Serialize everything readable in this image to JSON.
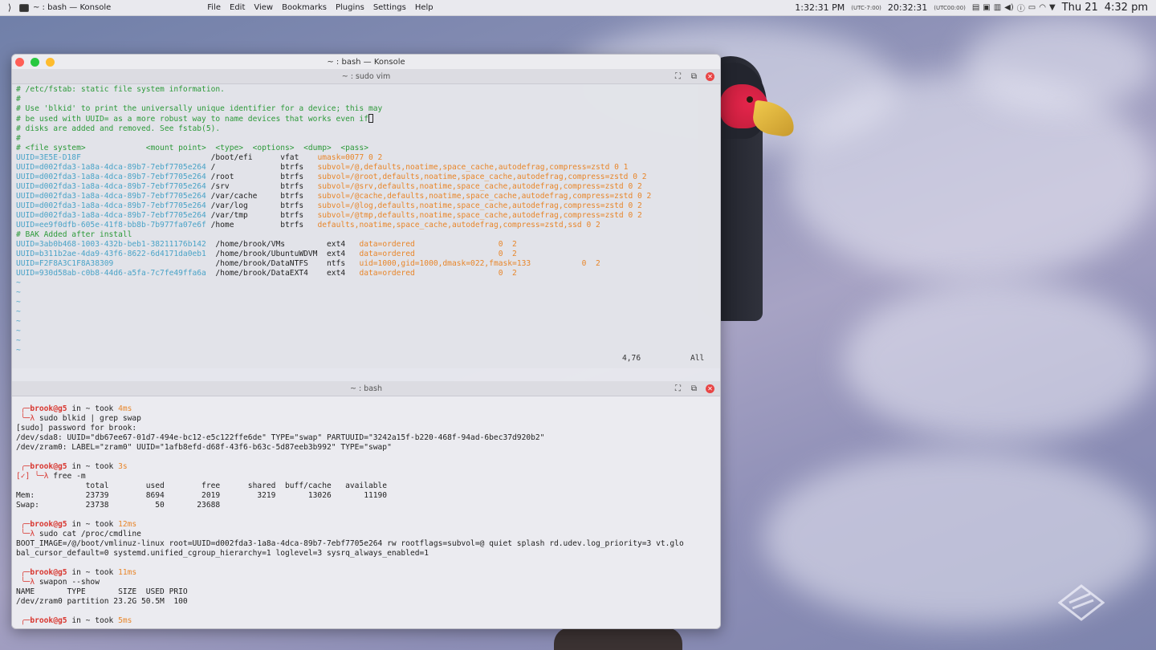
{
  "panel": {
    "launcher_icon": "plasma-launcher-icon",
    "app_title": "~ : bash — Konsole",
    "menu": [
      "File",
      "Edit",
      "View",
      "Bookmarks",
      "Plugins",
      "Settings",
      "Help"
    ],
    "clock1": "1:32:31 PM",
    "tz1": "(UTC-7:00)",
    "clock2": "20:32:31",
    "tz2": "(UTC00:00)",
    "day": "Thu 21",
    "time": "4:32 pm"
  },
  "window": {
    "title": "~ : bash — Konsole",
    "vim_pane_title": "~ : sudo vim",
    "bash_pane_title": "~ : bash"
  },
  "vim": {
    "comments": [
      "# /etc/fstab: static file system information.",
      "#",
      "# Use 'blkid' to print the universally unique identifier for a device; this may",
      "# be used with UUID= as a more robust way to name devices that works even if",
      "# disks are added and removed. See fstab(5).",
      "#",
      "# <file system>             <mount point>  <type>  <options>  <dump>  <pass>"
    ],
    "entries": [
      {
        "uuid": "UUID=3E5E-D18F",
        "pad": "                            ",
        "mp": "/boot/efi      ",
        "type": "vfat    ",
        "opts": "umask=0077 0 2"
      },
      {
        "uuid": "UUID=d002fda3-1a8a-4dca-89b7-7ebf7705e264",
        "pad": " ",
        "mp": "/              ",
        "type": "btrfs   ",
        "opts": "subvol=/@,defaults,noatime,space_cache,autodefrag,compress=zstd 0 1"
      },
      {
        "uuid": "UUID=d002fda3-1a8a-4dca-89b7-7ebf7705e264",
        "pad": " ",
        "mp": "/root          ",
        "type": "btrfs   ",
        "opts": "subvol=/@root,defaults,noatime,space_cache,autodefrag,compress=zstd 0 2"
      },
      {
        "uuid": "UUID=d002fda3-1a8a-4dca-89b7-7ebf7705e264",
        "pad": " ",
        "mp": "/srv           ",
        "type": "btrfs   ",
        "opts": "subvol=/@srv,defaults,noatime,space_cache,autodefrag,compress=zstd 0 2"
      },
      {
        "uuid": "UUID=d002fda3-1a8a-4dca-89b7-7ebf7705e264",
        "pad": " ",
        "mp": "/var/cache     ",
        "type": "btrfs   ",
        "opts": "subvol=/@cache,defaults,noatime,space_cache,autodefrag,compress=zstd 0 2"
      },
      {
        "uuid": "UUID=d002fda3-1a8a-4dca-89b7-7ebf7705e264",
        "pad": " ",
        "mp": "/var/log       ",
        "type": "btrfs   ",
        "opts": "subvol=/@log,defaults,noatime,space_cache,autodefrag,compress=zstd 0 2"
      },
      {
        "uuid": "UUID=d002fda3-1a8a-4dca-89b7-7ebf7705e264",
        "pad": " ",
        "mp": "/var/tmp       ",
        "type": "btrfs   ",
        "opts": "subvol=/@tmp,defaults,noatime,space_cache,autodefrag,compress=zstd 0 2"
      },
      {
        "uuid": "UUID=ee9f0dfb-605e-41f8-bb8b-7b977fa07e6f",
        "pad": " ",
        "mp": "/home          ",
        "type": "btrfs   ",
        "opts": "defaults,noatime,space_cache,autodefrag,compress=zstd,ssd 0 2"
      }
    ],
    "bak_comment": "# BAK Added after install",
    "bak_entries": [
      {
        "uuid": "UUID=3ab0b468-1003-432b-beb1-38211176b142",
        "pad": "  ",
        "mp": "/home/brook/VMs         ",
        "type": "ext4   ",
        "opts": "data=ordered                  0  2"
      },
      {
        "uuid": "UUID=b311b2ae-4da9-43f6-8622-6d4171da0eb1",
        "pad": "  ",
        "mp": "/home/brook/UbuntuWDVM  ",
        "type": "ext4   ",
        "opts": "data=ordered                  0  2"
      },
      {
        "uuid": "UUID=F2F8A3C1F8A38309",
        "pad": "                      ",
        "mp": "/home/brook/DataNTFS    ",
        "type": "ntfs   ",
        "opts": "uid=1000,gid=1000,dmask=022,fmask=133           0  2"
      },
      {
        "uuid": "UUID=930d58ab-c0b8-44d6-a5fa-7c7fe49ffa6a",
        "pad": "  ",
        "mp": "/home/brook/DataEXT4    ",
        "type": "ext4   ",
        "opts": "data=ordered                  0  2"
      }
    ],
    "tildes": [
      "~",
      "~",
      "~",
      "~",
      "~",
      "~",
      "~",
      "~"
    ],
    "status_pos": "4,76",
    "status_all": "All"
  },
  "bash": {
    "blocks": [
      {
        "prompt_user": "brook@g5",
        "prompt_mid": " in ~ took ",
        "took": "4ms",
        "cmd": "sudo blkid | grep swap",
        "check": "",
        "output": [
          "[sudo] password for brook:",
          "/dev/sda8: UUID=\"db67ee67-01d7-494e-bc12-e5c122ffe6de\" TYPE=\"swap\" PARTUUID=\"3242a15f-b220-468f-94ad-6bec37d920b2\"",
          "/dev/zram0: LABEL=\"zram0\" UUID=\"1afb8efd-d68f-43f6-b63c-5d87eeb3b992\" TYPE=\"swap\""
        ]
      },
      {
        "prompt_user": "brook@g5",
        "prompt_mid": " in ~ took ",
        "took": "3s",
        "cmd": "free -m",
        "check": "[✓]",
        "output": [
          "               total        used        free      shared  buff/cache   available",
          "Mem:           23739        8694        2019        3219       13026       11190",
          "Swap:          23738          50       23688"
        ]
      },
      {
        "prompt_user": "brook@g5",
        "prompt_mid": " in ~ took ",
        "took": "12ms",
        "cmd": "sudo cat /proc/cmdline",
        "check": "",
        "output": [
          "BOOT_IMAGE=/@/boot/vmlinuz-linux root=UUID=d002fda3-1a8a-4dca-89b7-7ebf7705e264 rw rootflags=subvol=@ quiet splash rd.udev.log_priority=3 vt.glo",
          "bal_cursor_default=0 systemd.unified_cgroup_hierarchy=1 loglevel=3 sysrq_always_enabled=1"
        ]
      },
      {
        "prompt_user": "brook@g5",
        "prompt_mid": " in ~ took ",
        "took": "11ms",
        "cmd": "swapon --show",
        "check": "",
        "output": [
          "NAME       TYPE       SIZE  USED PRIO",
          "/dev/zram0 partition 23.2G 50.5M  100"
        ]
      }
    ],
    "last_prompt_user": "brook@g5",
    "last_prompt_mid": " in ~ took ",
    "last_took": "5ms"
  }
}
